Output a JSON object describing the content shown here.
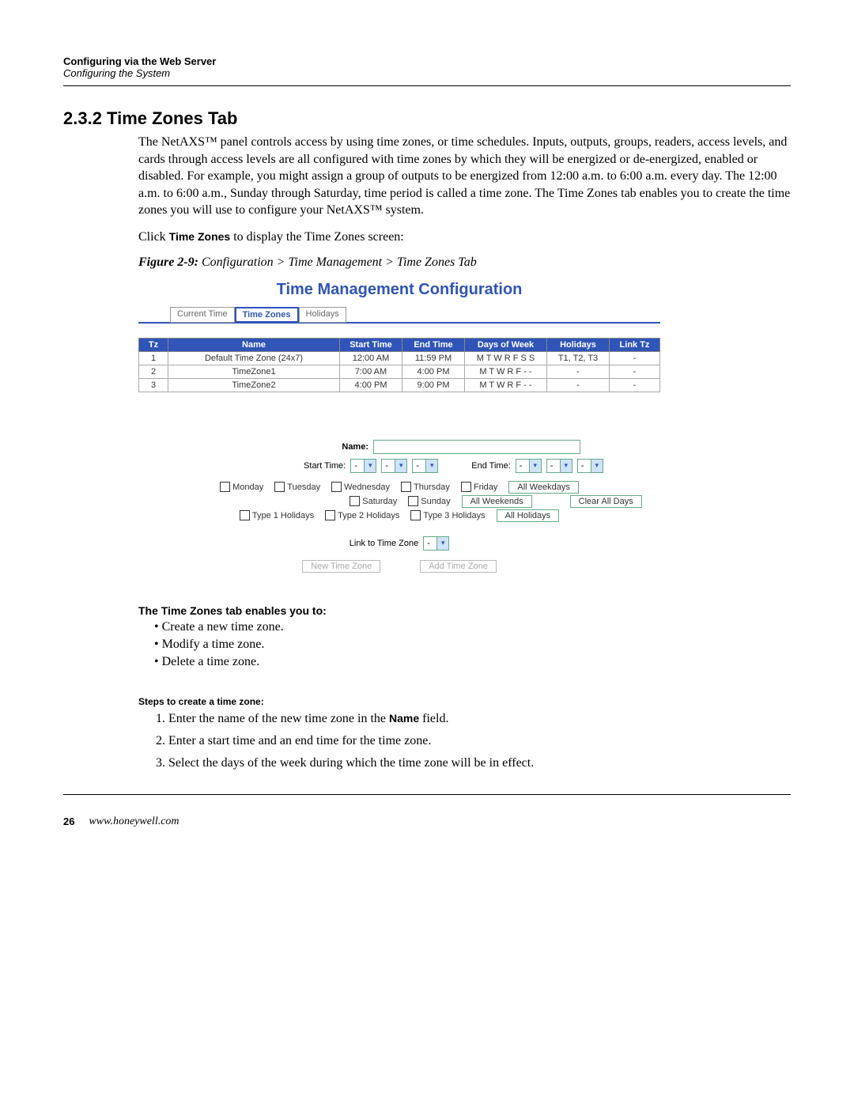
{
  "header": {
    "chapter": "Configuring via the Web Server",
    "section": "Configuring the System"
  },
  "heading": "2.3.2  Time Zones Tab",
  "para1": "The NetAXS™ panel controls access by using time zones, or time schedules. Inputs, outputs, groups, readers, access levels, and cards through access levels are all configured with time zones by which they will be energized or de-energized, enabled or disabled. For example, you might assign a group of outputs to be energized from 12:00 a.m. to 6:00 a.m. every day. The 12:00 a.m. to 6:00 a.m., Sunday through Saturday, time period is called a time zone. The Time Zones tab enables you to create the time zones you will use to configure your NetAXS™ system.",
  "para2_pre": "Click ",
  "para2_bold": "Time Zones",
  "para2_post": " to display the Time Zones screen:",
  "figcap_bold": "Figure 2-9:",
  "figcap_rest": "  Configuration > Time Management > Time Zones Tab",
  "ss": {
    "title": "Time Management Configuration",
    "tabs": {
      "left": "Current Time",
      "mid": "Time Zones",
      "right": "Holidays"
    },
    "cols": {
      "tz": "Tz",
      "name": "Name",
      "start": "Start Time",
      "end": "End Time",
      "dow": "Days of Week",
      "hol": "Holidays",
      "link": "Link Tz"
    },
    "rows": [
      {
        "tz": "1",
        "name": "Default Time Zone (24x7)",
        "start": "12:00 AM",
        "end": "11:59 PM",
        "dow": "M T W R F S S",
        "hol": "T1, T2, T3",
        "link": "-"
      },
      {
        "tz": "2",
        "name": "TimeZone1",
        "start": "7:00 AM",
        "end": "4:00 PM",
        "dow": "M T W R F - -",
        "hol": "-",
        "link": "-"
      },
      {
        "tz": "3",
        "name": "TimeZone2",
        "start": "4:00 PM",
        "end": "9:00 PM",
        "dow": "M T W R F - -",
        "hol": "-",
        "link": "-"
      }
    ],
    "labels": {
      "name": "Name:",
      "start": "Start Time:",
      "end": "End Time:",
      "mon": "Monday",
      "tue": "Tuesday",
      "wed": "Wednesday",
      "thu": "Thursday",
      "fri": "Friday",
      "sat": "Saturday",
      "sun": "Sunday",
      "t1": "Type 1 Holidays",
      "t2": "Type 2 Holidays",
      "t3": "Type 3 Holidays",
      "allwd": "All Weekdays",
      "allwe": "All Weekends",
      "clr": "Clear All Days",
      "allhol": "All Holidays",
      "link": "Link to Time Zone",
      "newtz": "New Time Zone",
      "addtz": "Add Time Zone",
      "dash": "-"
    }
  },
  "enables_head": "The Time Zones tab enables you to:",
  "enables": [
    "Create a new time zone.",
    "Modify a time zone.",
    "Delete a time zone."
  ],
  "steps_head": "Steps to create a time zone:",
  "steps": [
    {
      "pre": "Enter the name of the new time zone in the ",
      "bold": "Name",
      "post": " field."
    },
    {
      "pre": "Enter a start time and an end time for the time zone.",
      "bold": "",
      "post": ""
    },
    {
      "pre": "Select the days of the week during which the time zone will be in effect.",
      "bold": "",
      "post": ""
    }
  ],
  "footer": {
    "page": "26",
    "url": "www.honeywell.com"
  }
}
